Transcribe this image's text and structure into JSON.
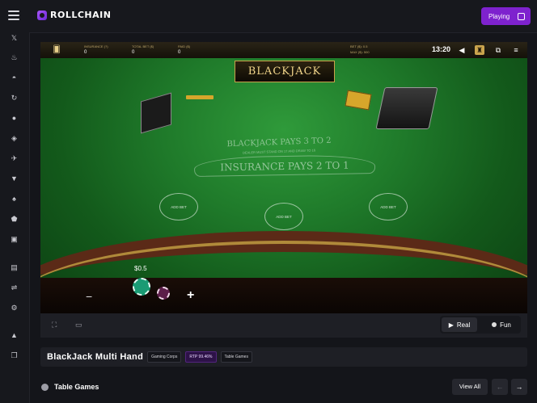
{
  "header": {
    "brand": "ROLLCHAIN",
    "playing_label": "Playing"
  },
  "sidebar": {
    "icons": [
      "menu-icon",
      "x-icon",
      "flame-icon",
      "controller-icon",
      "refresh-icon",
      "coin-icon",
      "shield-icon",
      "plane-icon",
      "award-icon",
      "fire-icon",
      "badge-icon",
      "gamepad-icon",
      "gift-icon",
      "link-icon",
      "gear-icon",
      "thumbs-up-icon",
      "copy-icon"
    ]
  },
  "game": {
    "hud": {
      "insurance_label": "INSURANCE (?)",
      "insurance_value": "0",
      "total_bet_label": "TOTAL BET ($)",
      "total_bet_value": "0",
      "paid_label": "PAID ($)",
      "paid_value": "0",
      "bet_label": "BET ($): 0.5",
      "bet_sub_label": "MAX ($): 500",
      "time": "13:20"
    },
    "brand_title": "BLACKJACK",
    "rules": {
      "line1": "BLACKJACK PAYS 3 TO 2",
      "line2": "DEALER MUST STAND ON 17 AND DRAW TO 16",
      "line3": "INSURANCE PAYS 2 TO 1"
    },
    "bet_spots": [
      "ADD BET",
      "ADD BET",
      "ADD BET"
    ],
    "chip_value": "$0.5",
    "minus": "−",
    "plus": "+"
  },
  "modes": {
    "real": "Real",
    "fun": "Fun"
  },
  "info": {
    "title": "BlackJack Multi Hand",
    "tags": [
      "Gaming Corps",
      "RTP 99.46%",
      "Table Games"
    ]
  },
  "section": {
    "title": "Table Games",
    "view_all": "View All",
    "prev": "←",
    "next": "→"
  },
  "colors": {
    "accent": "#7e22ce",
    "felt": "#1f7a2a",
    "gold": "#d6a62b"
  }
}
